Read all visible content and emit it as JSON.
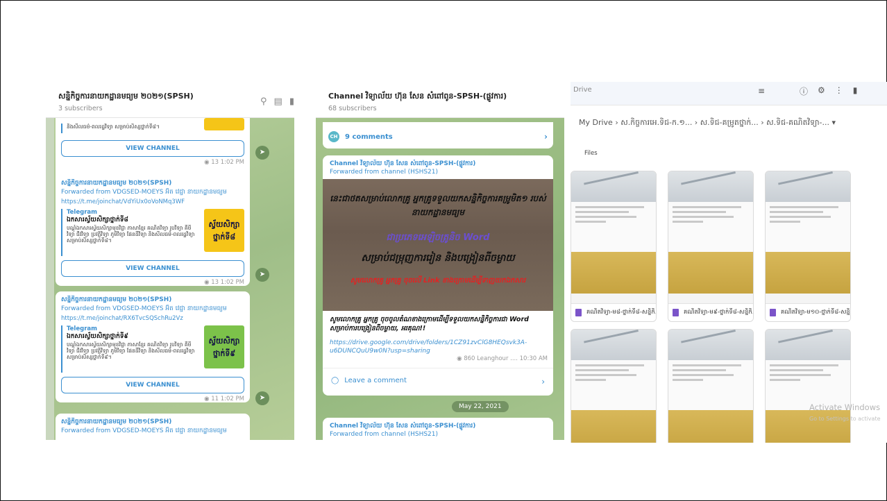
{
  "panel1": {
    "channel_title": "សន្និកិច្ចការនាយកដ្ឋានមធ្យម ២០២១(SPSH)",
    "subscribers": "3 subscribers",
    "messages": [
      {
        "title": "",
        "forwarded": "",
        "link": "",
        "preview_source": "",
        "preview_heading": "",
        "preview_body": "និងសីលធម៌-ពលរដ្ឋវិទ្យា សម្រាប់សិស្សថ្នាក់ទី៨។",
        "thumb": "",
        "button": "VIEW CHANNEL",
        "meta": "13 1:02 PM"
      },
      {
        "title": "សន្និកិច្ចការនាយកដ្ឋានមធ្យម ២០២១(SPSH)",
        "forwarded": "Forwarded from VDGSED-MOEYS អ៊ិត វេជ្ជា នាយកដ្ឋានមធ្យម",
        "link": "https://t.me/joinchat/VdYiUx0oVoNMq3WF",
        "preview_source": "Telegram",
        "preview_heading": "ឯកសារស្វ័យសិក្សាថ្នាក់ទី៨",
        "preview_body": "បណ្ដុំឯកសារស្វ័យសិក្សាមុខវិជ្ជា ភាសាខ្មែរ គណិតវិទ្យា រូបវិទ្យា គីមីវិទ្យា ជីវវិទ្យា ប្រវត្តិវិទ្យា ភូមិវិទ្យា ផែនដីវិទ្យា និងសីលធម៌-ពលរដ្ឋវិទ្យា សម្រាប់សិស្សថ្នាក់ទី៨។",
        "thumb": "ស្វ័យសិក្សា ថ្នាក់ទី៨",
        "button": "VIEW CHANNEL",
        "meta": "13 1:02 PM"
      },
      {
        "title": "សន្និកិច្ចការនាយកដ្ឋានមធ្យម ២០២១(SPSH)",
        "forwarded": "Forwarded from VDGSED-MOEYS អ៊ិត វេជ្ជា នាយកដ្ឋានមធ្យម",
        "link": "https://t.me/joinchat/RX6TvcSQSchRu2Vz",
        "preview_source": "Telegram",
        "preview_heading": "ឯកសារស្វ័យសិក្សាថ្នាក់ទី៩",
        "preview_body": "បណ្ដុំឯកសារស្វ័យសិក្សាមុខវិជ្ជា ភាសាខ្មែរ គណិតវិទ្យា រូបវិទ្យា គីមីវិទ្យា ជីវវិទ្យា ប្រវត្តិវិទ្យា ភូមិវិទ្យា ផែនដីវិទ្យា និងសីលធម៌-ពលរដ្ឋវិទ្យា សម្រាប់សិស្សថ្នាក់ទី៩។",
        "thumb": "ស្វ័យសិក្សា ថ្នាក់ទី៩",
        "button": "VIEW CHANNEL",
        "meta": "11 1:02 PM"
      },
      {
        "title": "សន្និកិច្ចការនាយកដ្ឋានមធ្យម ២០២១(SPSH)",
        "forwarded": "Forwarded from VDGSED-MOEYS អ៊ិត វេជ្ជា នាយកដ្ឋានមធ្យម"
      }
    ],
    "thumb_colors": [
      "#f5c518",
      "#f5c518",
      "#7cc24a"
    ]
  },
  "panel2": {
    "channel_title": "Channel វិទ្យាល័យ ហ៊ុន សែន សំពៅពូន-SPSH-(ផ្លូវការ)",
    "subscribers": "68 subscribers",
    "comments": "9 comments",
    "post_title": "Channel វិទ្យាល័យ ហ៊ុន សែន សំពៅពូន-SPSH-(ផ្លូវការ)",
    "post_forwarded": "Forwarded from channel (HSHS21)",
    "image_lines": [
      "នេះជាថតសម្រាប់លោកគ្រូ អ្នកគ្រូទទួលយកសន្និកិច្ចការគម្រូមិត១ របស់នាយកដ្ឋានមធ្យម",
      "ជាប្រភេទអេឡិចត្រូនិច Word",
      "សម្រាប់ជម្រុញការរៀន និងបង្រៀនពីចម្ងាយ",
      "សូមលោកគ្រូ អ្នកគ្រូ ចុចលើ Link ខាងក្រោមដើម្បីទាញយកឯកសារ"
    ],
    "post_text": "សូមលោកគ្រូ អ្នកគ្រូ ចុចចូលតំណខាងក្រោមដើម្បីទទួលយកសន្និកិច្ចការជា Word សម្រាប់ការបង្រៀនពីចម្ងាយ, អរគុណ!!",
    "post_link": "https://drive.google.com/drive/folders/1CZ91zvClG8HEQsvk3A-u6DUNCQuU9w0N?usp=sharing",
    "post_meta": "860  Leanghour .... 10:30 AM",
    "leave_comment": "Leave a comment",
    "date_pill": "May 22, 2021",
    "next_title": "Channel វិទ្យាល័យ ហ៊ុន សែន សំពៅពូន-SPSH-(ផ្លូវការ)",
    "next_forwarded": "Forwarded from channel (HSHS21)"
  },
  "panel3": {
    "search_label": "Drive",
    "breadcrumb": "My Drive  ›  ស.កិច្ចការអេ.ទិជ-ក.១...  ›  ស.ទិជ-គម្រូតថ្នាក់...  ›  ស.ទិជ-គណិតវិទ្យា-...  ▾",
    "files_label": "Files",
    "tile_name": "គណិតវិទ្យា-ម៨-ថ្នាក់ទី៨-សន្និកិ...",
    "tiles": [
      "គណិតវិទ្យា-ម៨-ថ្នាក់ទី៨-សន្និកិ...",
      "គណិតវិទ្យា-ម៩-ថ្នាក់ទី៨-សន្និកិ...",
      "គណិតវិទ្យា-ម១០-ថ្នាក់ទី៨-សន្និក...",
      "",
      "",
      ""
    ],
    "watermark": "Activate Windows",
    "watermark_sub": "Go to Settings to activate"
  }
}
